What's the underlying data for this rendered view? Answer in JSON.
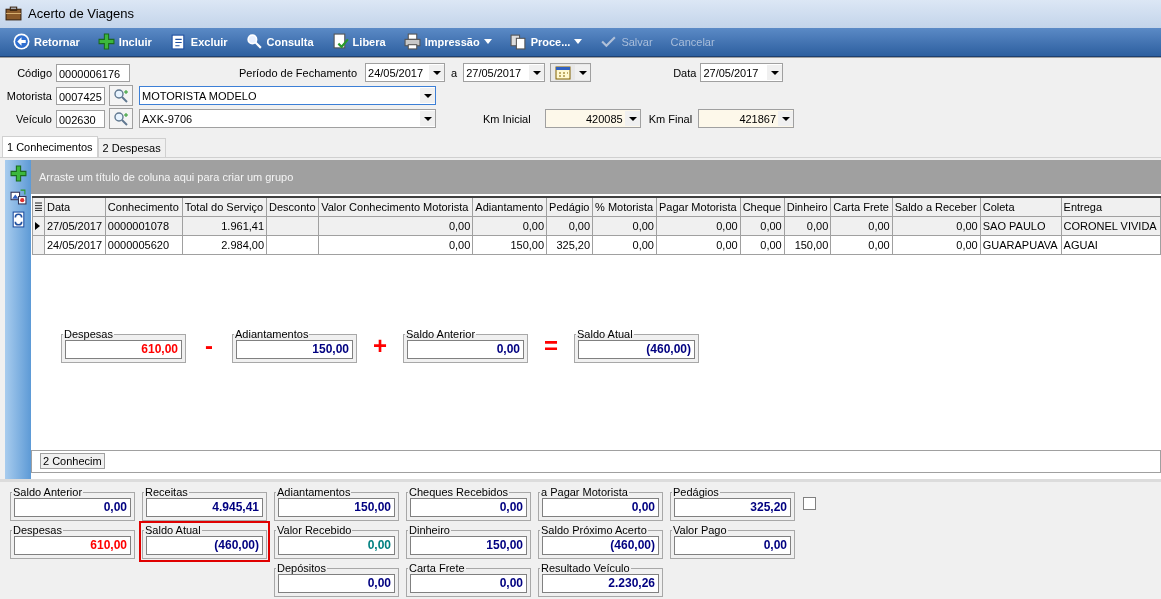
{
  "window": {
    "title": "Acerto de Viagens"
  },
  "toolbar": [
    {
      "label": "Retornar",
      "kind": "back",
      "disabled": false,
      "menu": false
    },
    {
      "label": "Incluir",
      "kind": "add",
      "disabled": false,
      "menu": false
    },
    {
      "label": "Excluir",
      "kind": "delete",
      "disabled": false,
      "menu": false
    },
    {
      "label": "Consulta",
      "kind": "search",
      "disabled": false,
      "menu": false
    },
    {
      "label": "Libera",
      "kind": "approve",
      "disabled": false,
      "menu": false
    },
    {
      "label": "Impressão",
      "kind": "print",
      "disabled": false,
      "menu": true
    },
    {
      "label": "Proce...",
      "kind": "process",
      "disabled": false,
      "menu": true
    },
    {
      "label": "Salvar",
      "kind": "check",
      "disabled": true,
      "menu": false
    },
    {
      "label": "Cancelar",
      "kind": "plain",
      "disabled": true,
      "menu": false
    }
  ],
  "form": {
    "codigo": {
      "label": "Código",
      "value": "0000006176"
    },
    "periodo": {
      "label": "Período de Fechamento",
      "from": "24/05/2017",
      "separator": "a",
      "to": "27/05/2017"
    },
    "data": {
      "label": "Data",
      "value": "27/05/2017"
    },
    "motorista": {
      "label": "Motorista",
      "code": "0007425",
      "name": "MOTORISTA MODELO",
      "focused": true
    },
    "veiculo": {
      "label": "Veículo",
      "code": "002630",
      "name": "AXK-9706",
      "focused": false
    },
    "km_inicial": {
      "label": "Km Inicial",
      "value": "420085"
    },
    "km_final": {
      "label": "Km Final",
      "value": "421867"
    }
  },
  "tabs": [
    {
      "label": "1 Conhecimentos",
      "selected": true
    },
    {
      "label": "2 Despesas",
      "selected": false
    }
  ],
  "grid": {
    "group_hint": "Arraste um título de coluna aqui para criar um grupo",
    "columns": [
      {
        "label": "Data",
        "numeric": false
      },
      {
        "label": "Conhecimento",
        "numeric": false
      },
      {
        "label": "Total do Serviço",
        "numeric": true
      },
      {
        "label": "Desconto",
        "numeric": true
      },
      {
        "label": "Valor Conhecimento Motorista",
        "numeric": true
      },
      {
        "label": "Adiantamento",
        "numeric": true
      },
      {
        "label": "Pedágio",
        "numeric": true
      },
      {
        "label": "% Motorista",
        "numeric": true
      },
      {
        "label": "Pagar Motorista",
        "numeric": true
      },
      {
        "label": "Cheque",
        "numeric": true
      },
      {
        "label": "Dinheiro",
        "numeric": true
      },
      {
        "label": "Carta Frete",
        "numeric": true
      },
      {
        "label": "Saldo a Receber",
        "numeric": true
      },
      {
        "label": "Coleta",
        "numeric": false
      },
      {
        "label": "Entrega",
        "numeric": false
      }
    ],
    "rows": [
      {
        "selected": true,
        "cells": [
          "27/05/2017",
          "0000001078",
          "1.961,41",
          "",
          "0,00",
          "0,00",
          "0,00",
          "0,00",
          "0,00",
          "0,00",
          "0,00",
          "0,00",
          "0,00",
          "SAO PAULO",
          "CORONEL VIVIDA"
        ]
      },
      {
        "selected": false,
        "cells": [
          "24/05/2017",
          "0000005620",
          "2.984,00",
          "",
          "0,00",
          "150,00",
          "325,20",
          "0,00",
          "0,00",
          "0,00",
          "150,00",
          "0,00",
          "0,00",
          "GUARAPUAVA",
          "AGUAI"
        ]
      }
    ],
    "footer": "2 Conhecim"
  },
  "formula": [
    {
      "kind": "box",
      "label": "Despesas",
      "value": "610,00",
      "color": "#ff0000"
    },
    {
      "kind": "operator",
      "symbol": "-"
    },
    {
      "kind": "box",
      "label": "Adiantamentos",
      "value": "150,00",
      "color": "#000080"
    },
    {
      "kind": "operator",
      "symbol": "+"
    },
    {
      "kind": "box",
      "label": "Saldo Anterior",
      "value": "0,00",
      "color": "#000080"
    },
    {
      "kind": "operator",
      "symbol": "="
    },
    {
      "kind": "box",
      "label": "Saldo Atual",
      "value": "(460,00)",
      "color": "#000080"
    }
  ],
  "totals": [
    [
      {
        "label": "Saldo Anterior",
        "value": "0,00",
        "color": "#000080",
        "highlighted": false
      },
      {
        "label": "Despesas",
        "value": "610,00",
        "color": "#ff0000",
        "highlighted": false
      }
    ],
    [
      {
        "label": "Receitas",
        "value": "4.945,41",
        "color": "#000080",
        "highlighted": false
      },
      {
        "label": "Saldo Atual",
        "value": "(460,00)",
        "color": "#000080",
        "highlighted": true
      }
    ],
    [
      {
        "label": "Adiantamentos",
        "value": "150,00",
        "color": "#000080",
        "highlighted": false
      },
      {
        "label": "Valor Recebido",
        "value": "0,00",
        "color": "#008080",
        "highlighted": false
      },
      {
        "label": "Depósitos",
        "value": "0,00",
        "color": "#000080",
        "highlighted": false
      }
    ],
    [
      {
        "label": "Cheques Recebidos",
        "value": "0,00",
        "color": "#000080",
        "highlighted": false
      },
      {
        "label": "Dinheiro",
        "value": "150,00",
        "color": "#000080",
        "highlighted": false
      },
      {
        "label": "Carta Frete",
        "value": "0,00",
        "color": "#000080",
        "highlighted": false
      }
    ],
    [
      {
        "label": "a Pagar Motorista",
        "value": "0,00",
        "color": "#000080",
        "highlighted": false
      },
      {
        "label": "Saldo Próximo Acerto",
        "value": "(460,00)",
        "color": "#000080",
        "highlighted": false
      },
      {
        "label": "Resultado Veículo",
        "value": "2.230,26",
        "color": "#000080",
        "highlighted": false
      }
    ],
    [
      {
        "label": "Pedágios",
        "value": "325,20",
        "color": "#000080",
        "highlighted": false,
        "checkbox": {
          "checked": false
        }
      },
      {
        "label": "Valor Pago",
        "value": "0,00",
        "color": "#000080",
        "highlighted": false
      }
    ]
  ]
}
